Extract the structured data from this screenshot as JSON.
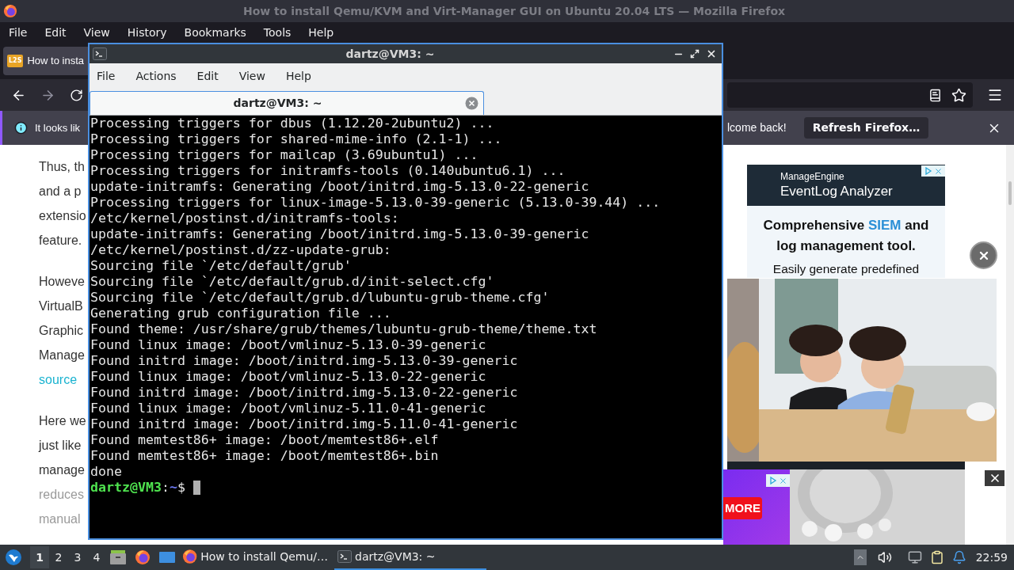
{
  "browser": {
    "title": "How to install Qemu/KVM and Virt-Manager GUI on Ubuntu 20.04 LTS — Mozilla Firefox",
    "menu": [
      "File",
      "Edit",
      "View",
      "History",
      "Bookmarks",
      "Tools",
      "Help"
    ],
    "tab": {
      "favicon": "L2S",
      "label": "How to insta",
      "selected": true
    },
    "notification": {
      "text_left": "It looks lik",
      "text_right": "lcome back!",
      "button": "Refresh Firefox…"
    }
  },
  "article": {
    "paragraphs": [
      [
        {
          "kind": "text",
          "text": "Thus, th"
        },
        {
          "kind": "text",
          "text": "and a p"
        },
        {
          "kind": "text",
          "text": "extensio"
        },
        {
          "kind": "text",
          "text": "feature."
        }
      ],
      [
        {
          "kind": "text",
          "text": "Howeve"
        },
        {
          "kind": "text",
          "text": "VirtualB"
        },
        {
          "kind": "text",
          "text": "Graphic"
        },
        {
          "kind": "text",
          "text": "Manage"
        },
        {
          "kind": "link",
          "text": "source"
        }
      ],
      [
        {
          "kind": "text",
          "text": "Here we"
        },
        {
          "kind": "text",
          "text": "just like"
        },
        {
          "kind": "text",
          "text": "manage"
        },
        {
          "kind": "faded",
          "text": "reduces"
        },
        {
          "kind": "faded",
          "text": "manual"
        }
      ]
    ]
  },
  "ad": {
    "brand": "ManageEngine",
    "product": "EventLog Analyzer",
    "headline_before": "Comprehensive",
    "headline_highlight": "SIEM",
    "headline_after": "and",
    "headline_line2": "log management tool.",
    "body": "Easily generate predefined"
  },
  "bottom_ad": {
    "button": "MORE"
  },
  "terminal": {
    "title": "dartz@VM3: ~",
    "menu": [
      "File",
      "Actions",
      "Edit",
      "View",
      "Help"
    ],
    "tab": {
      "label": "dartz@VM3: ~",
      "selected": true
    },
    "lines": [
      "Processing triggers for dbus (1.12.20-2ubuntu2) ...",
      "Processing triggers for shared-mime-info (2.1-1) ...",
      "Processing triggers for mailcap (3.69ubuntu1) ...",
      "Processing triggers for initramfs-tools (0.140ubuntu6.1) ...",
      "update-initramfs: Generating /boot/initrd.img-5.13.0-22-generic",
      "Processing triggers for linux-image-5.13.0-39-generic (5.13.0-39.44) ...",
      "/etc/kernel/postinst.d/initramfs-tools:",
      "update-initramfs: Generating /boot/initrd.img-5.13.0-39-generic",
      "/etc/kernel/postinst.d/zz-update-grub:",
      "Sourcing file `/etc/default/grub'",
      "Sourcing file `/etc/default/grub.d/init-select.cfg'",
      "Sourcing file `/etc/default/grub.d/lubuntu-grub-theme.cfg'",
      "Generating grub configuration file ...",
      "Found theme: /usr/share/grub/themes/lubuntu-grub-theme/theme.txt",
      "Found linux image: /boot/vmlinuz-5.13.0-39-generic",
      "Found initrd image: /boot/initrd.img-5.13.0-39-generic",
      "Found linux image: /boot/vmlinuz-5.13.0-22-generic",
      "Found initrd image: /boot/initrd.img-5.13.0-22-generic",
      "Found linux image: /boot/vmlinuz-5.11.0-41-generic",
      "Found initrd image: /boot/initrd.img-5.11.0-41-generic",
      "Found memtest86+ image: /boot/memtest86+.elf",
      "Found memtest86+ image: /boot/memtest86+.bin",
      "done"
    ],
    "prompt": {
      "user_host": "dartz@VM3",
      "separator": ":",
      "path": "~",
      "symbol": "$"
    }
  },
  "taskbar": {
    "workspaces": [
      {
        "label": "1",
        "selected": true
      },
      {
        "label": "2",
        "selected": false
      },
      {
        "label": "3",
        "selected": false
      },
      {
        "label": "4",
        "selected": false
      }
    ],
    "tasks": [
      {
        "kind": "browser",
        "label": "How to install Qemu/…",
        "selected": false
      },
      {
        "kind": "terminal",
        "label": "dartz@VM3: ~",
        "selected": true
      }
    ],
    "clock": "22:59"
  }
}
